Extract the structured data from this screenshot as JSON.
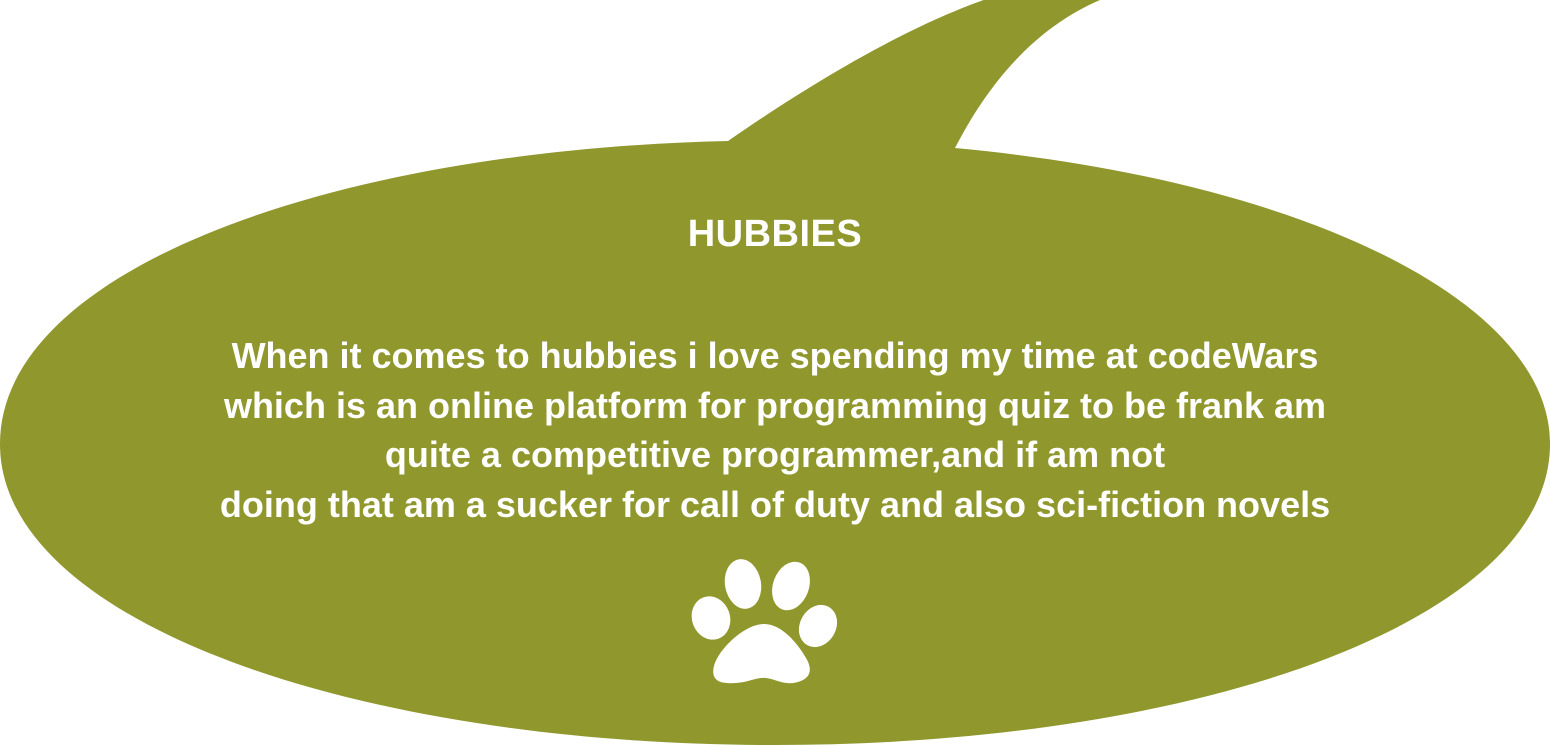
{
  "bubble": {
    "color": "#8f972d",
    "heading": "HUBBIES",
    "lines": [
      "When it comes to hubbies i love spending my time at codeWars",
      "which is an online platform for programming quiz to be frank am",
      "quite a competitive programmer,and if am not",
      "doing that am a sucker for call of duty and also sci-fiction novels"
    ],
    "icon": "paw-print-icon"
  }
}
